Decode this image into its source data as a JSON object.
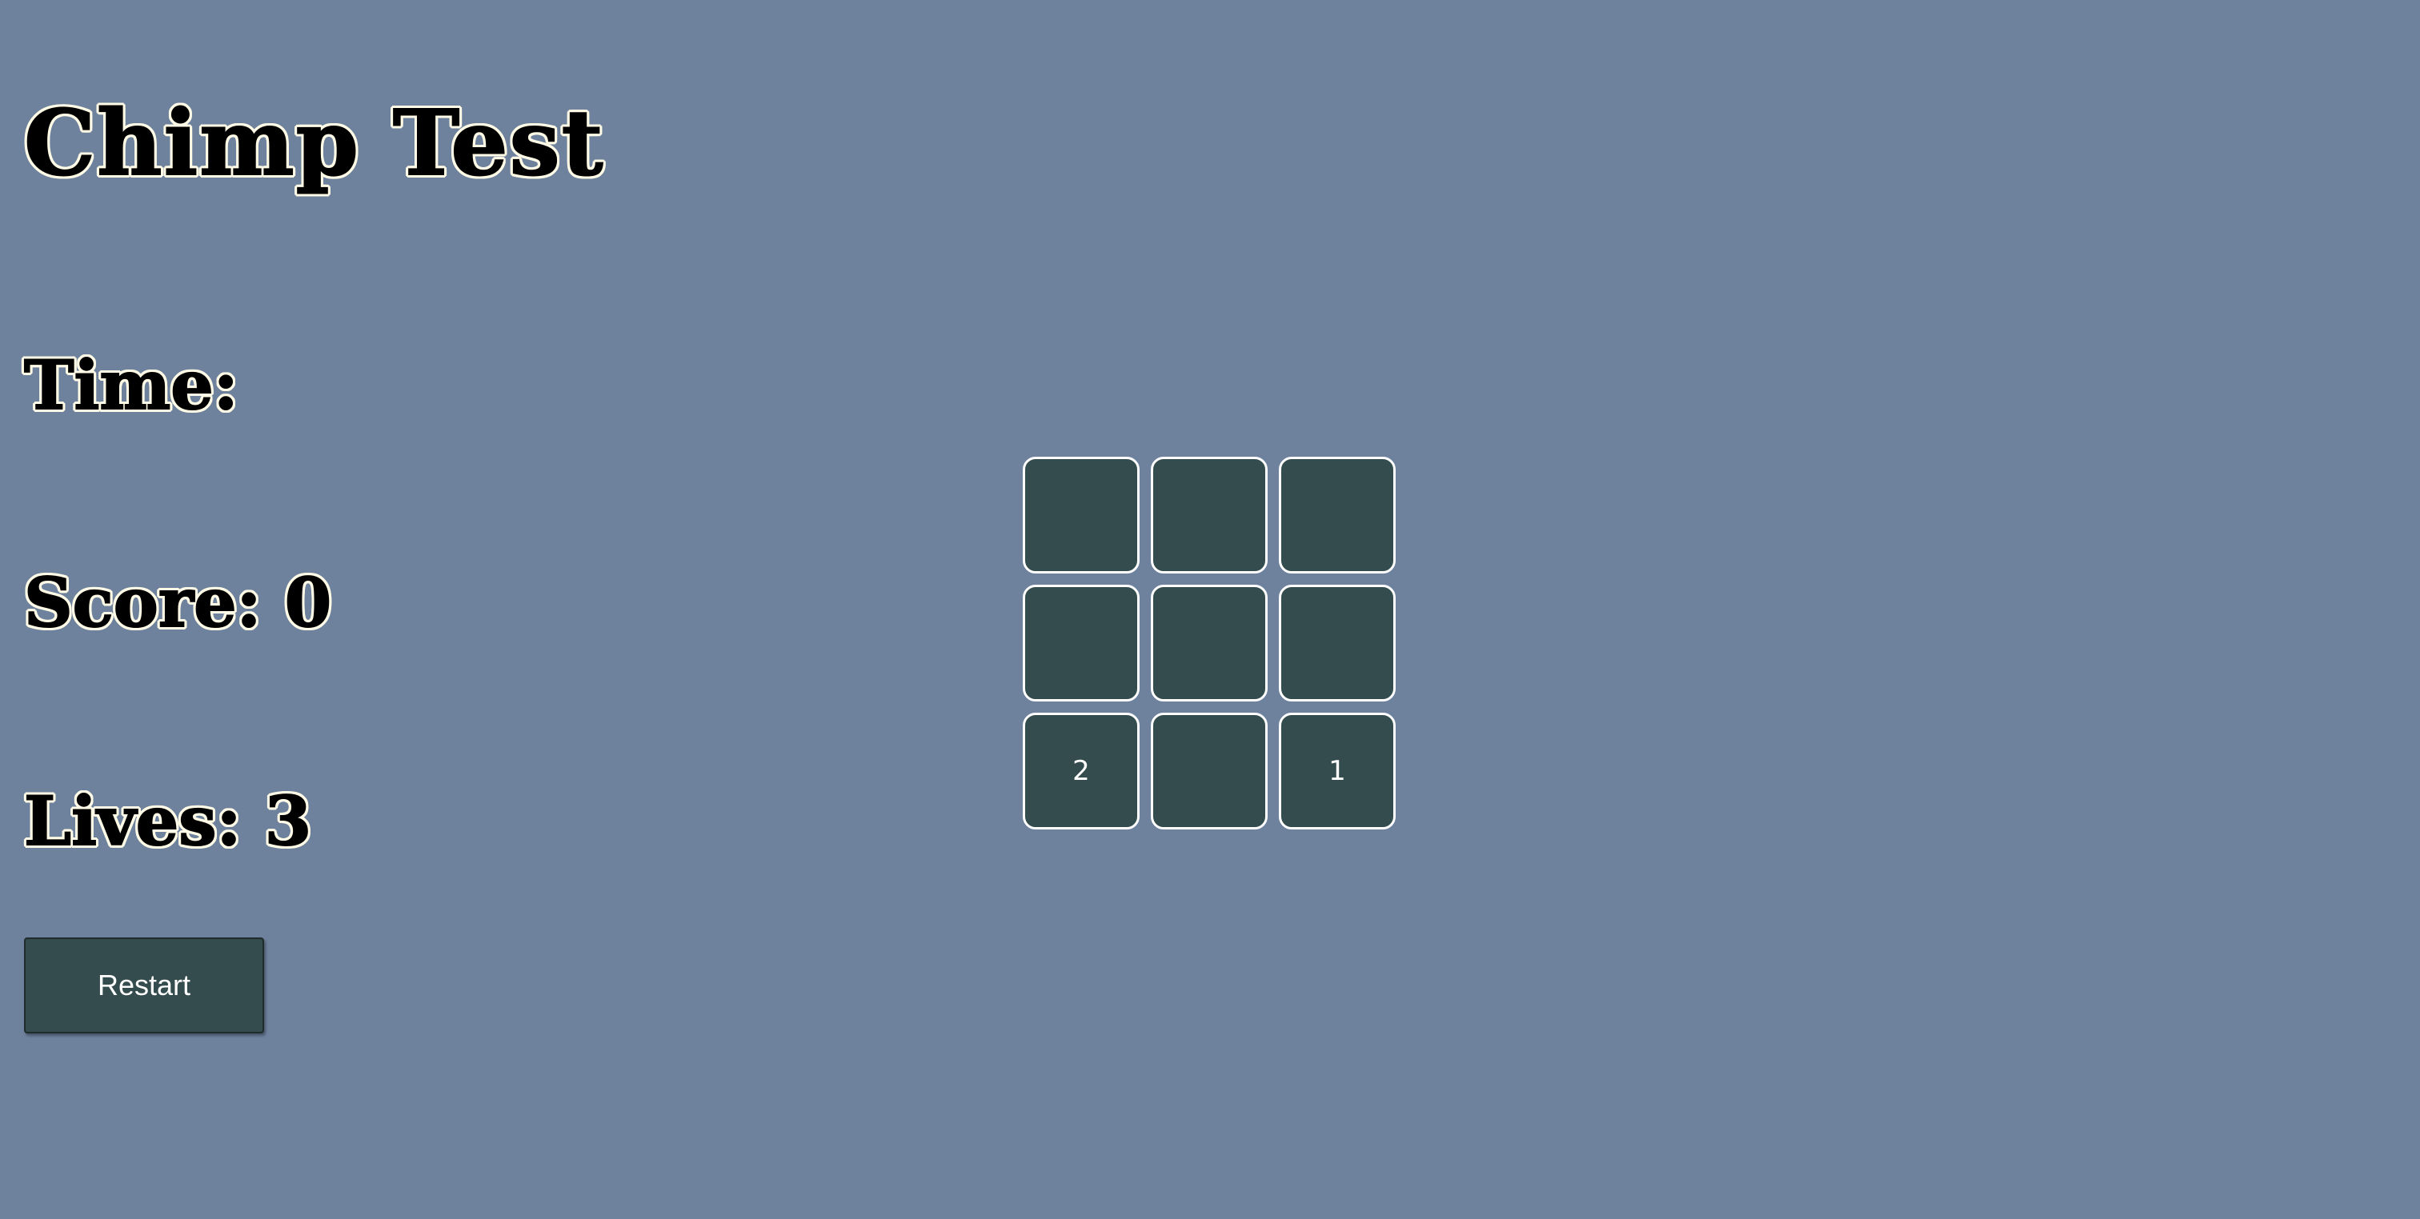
{
  "title": "Chimp Test",
  "stats": {
    "time_label": "Time:",
    "time_value": "",
    "score_label": "Score:",
    "score_value": "0",
    "lives_label": "Lives:",
    "lives_value": "3"
  },
  "restart_label": "Restart",
  "grid": {
    "cells": [
      "",
      "",
      "",
      "",
      "",
      "",
      "2",
      "",
      "1"
    ]
  },
  "colors": {
    "background": "#6e829e",
    "tile": "#344c4e",
    "tile_border": "#ffffff",
    "text_outline": "#fffbe6"
  }
}
